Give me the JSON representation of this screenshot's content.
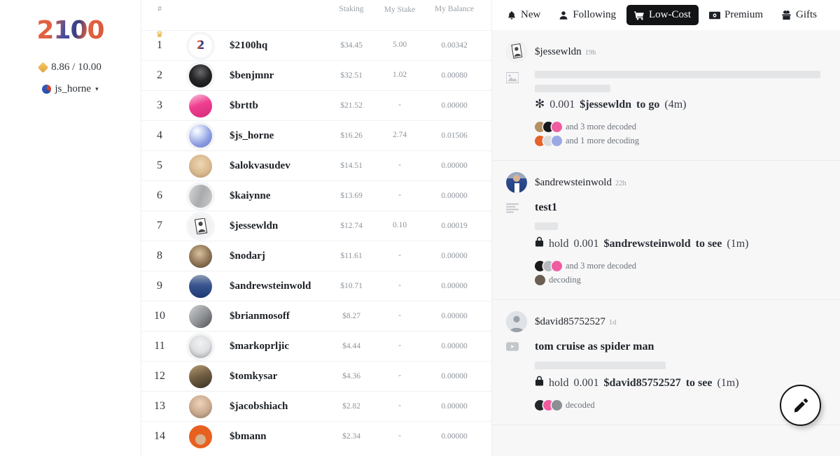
{
  "sidebar": {
    "logo": "2100",
    "credits": "8.86 / 10.00",
    "username": "js_horne",
    "caret": "▾"
  },
  "leaderboard": {
    "headers": {
      "rank": "#",
      "avatar": "",
      "name": "",
      "staking": "Staking",
      "my_stake": "My Stake",
      "my_balance": "My Balance"
    },
    "rows": [
      {
        "rank": "1",
        "name": "$2100hq",
        "staking": "$34.45",
        "my_stake": "5.00",
        "my_balance": "0.00342",
        "crown": "♛",
        "avatar_kind": "logo2",
        "avatar_color": "#ffffff"
      },
      {
        "rank": "2",
        "name": "$benjmnr",
        "staking": "$32.51",
        "my_stake": "1.02",
        "my_balance": "0.00080",
        "crown": "",
        "avatar_kind": "photo-dark",
        "avatar_color": "#1b1b1d"
      },
      {
        "rank": "3",
        "name": "$brttb",
        "staking": "$21.52",
        "my_stake": "-",
        "my_balance": "0.00000",
        "crown": "",
        "avatar_kind": "photo-pink",
        "avatar_color": "#f05ca0"
      },
      {
        "rank": "4",
        "name": "$js_horne",
        "staking": "$16.26",
        "my_stake": "2.74",
        "my_balance": "0.01506",
        "crown": "",
        "avatar_kind": "orb",
        "avatar_color": "#98a8e8"
      },
      {
        "rank": "5",
        "name": "$alokvasudev",
        "staking": "$14.51",
        "my_stake": "-",
        "my_balance": "0.00000",
        "crown": "",
        "avatar_kind": "photo-tan",
        "avatar_color": "#d8c0a0"
      },
      {
        "rank": "6",
        "name": "$kaiynne",
        "staking": "$13.69",
        "my_stake": "-",
        "my_balance": "0.00000",
        "crown": "",
        "avatar_kind": "photo-grey",
        "avatar_color": "#b7b9bb"
      },
      {
        "rank": "7",
        "name": "$jessewldn",
        "staking": "$12.74",
        "my_stake": "0.10",
        "my_balance": "0.00019",
        "crown": "",
        "avatar_kind": "card",
        "avatar_color": "#f2f2f3"
      },
      {
        "rank": "8",
        "name": "$nodarj",
        "staking": "$11.61",
        "my_stake": "-",
        "my_balance": "0.00000",
        "crown": "",
        "avatar_kind": "photo-warm",
        "avatar_color": "#8a7560"
      },
      {
        "rank": "9",
        "name": "$andrewsteinwold",
        "staking": "$10.71",
        "my_stake": "-",
        "my_balance": "0.00000",
        "crown": "",
        "avatar_kind": "photo-blue",
        "avatar_color": "#2b4a8c"
      },
      {
        "rank": "10",
        "name": "$brianmosoff",
        "staking": "$8.27",
        "my_stake": "-",
        "my_balance": "0.00000",
        "crown": "",
        "avatar_kind": "photo-grey2",
        "avatar_color": "#9ea2a6"
      },
      {
        "rank": "11",
        "name": "$markoprljic",
        "staking": "$4.44",
        "my_stake": "-",
        "my_balance": "0.00000",
        "crown": "",
        "avatar_kind": "photo-light",
        "avatar_color": "#e3e4e6"
      },
      {
        "rank": "12",
        "name": "$tomkysar",
        "staking": "$4.36",
        "my_stake": "-",
        "my_balance": "0.00000",
        "crown": "",
        "avatar_kind": "photo-sepia",
        "avatar_color": "#9b8463"
      },
      {
        "rank": "13",
        "name": "$jacobshiach",
        "staking": "$2.82",
        "my_stake": "-",
        "my_balance": "0.00000",
        "crown": "",
        "avatar_kind": "photo-skin",
        "avatar_color": "#c9a98e"
      },
      {
        "rank": "14",
        "name": "$bmann",
        "staking": "$2.34",
        "my_stake": "-",
        "my_balance": "0.00000",
        "crown": "",
        "avatar_kind": "photo-orange",
        "avatar_color": "#e8601f"
      }
    ]
  },
  "topnav": {
    "items": [
      {
        "label": "New",
        "icon": "bell-icon",
        "active": false
      },
      {
        "label": "Following",
        "icon": "person-icon",
        "active": false
      },
      {
        "label": "Low-Cost",
        "icon": "cart-icon",
        "active": true
      },
      {
        "label": "Premium",
        "icon": "banknote-icon",
        "active": false
      },
      {
        "label": "Gifts",
        "icon": "gift-icon",
        "active": false
      }
    ]
  },
  "feed": {
    "posts": [
      {
        "author": "$jessewldn",
        "time": "19h",
        "type_icon": "image-icon",
        "title": "",
        "skeletons": [
          {
            "w": "98%"
          },
          {
            "w": "26%"
          }
        ],
        "unlock_prefix_icon": "asterisk-icon",
        "unlock_glyph": "✻",
        "unlock_amount": "0.001",
        "unlock_token": "$jessewldn",
        "unlock_action": "to go",
        "unlock_timer": "(4m)",
        "decoded_text": "and 3 more decoded",
        "decoding_text": "and 1 more decoding",
        "decoded_colors": [
          "#b38f63",
          "#1a1a1c",
          "#f05ca0"
        ],
        "decoding_colors": [
          "#e8602a",
          "#dcdcdd",
          "#9aa8e6"
        ]
      },
      {
        "author": "$andrewsteinwold",
        "time": "22h",
        "type_icon": "text-lines-icon",
        "title": "test1",
        "skeletons": [
          {
            "w": "8%"
          }
        ],
        "unlock_prefix_icon": "lock-icon",
        "unlock_glyph": "🔒",
        "unlock_amount": "0.001",
        "unlock_token": "$andrewsteinwold",
        "unlock_action": "to see",
        "unlock_prefix_word": "hold",
        "unlock_timer": "(1m)",
        "decoded_text": "and 3 more decoded",
        "decoding_text": "decoding",
        "decoded_colors": [
          "#1a1a1c",
          "#b9bbbe",
          "#f05ca0"
        ],
        "decoding_colors": [
          "#6d5e52"
        ]
      },
      {
        "author": "$david85752527",
        "time": "1d",
        "type_icon": "video-icon",
        "title": "tom cruise as spider man",
        "skeletons": [
          {
            "w": "45%"
          }
        ],
        "unlock_prefix_icon": "lock-icon",
        "unlock_glyph": "🔒",
        "unlock_amount": "0.001",
        "unlock_token": "$david85752527",
        "unlock_action": "to see",
        "unlock_prefix_word": "hold",
        "unlock_timer": "(1m)",
        "decoded_text": "decoded",
        "decoding_text": "",
        "decoded_colors": [
          "#25262a",
          "#f05ca0",
          "#8c8f93"
        ],
        "decoding_colors": []
      }
    ],
    "compose_button": "edit-pencil"
  }
}
